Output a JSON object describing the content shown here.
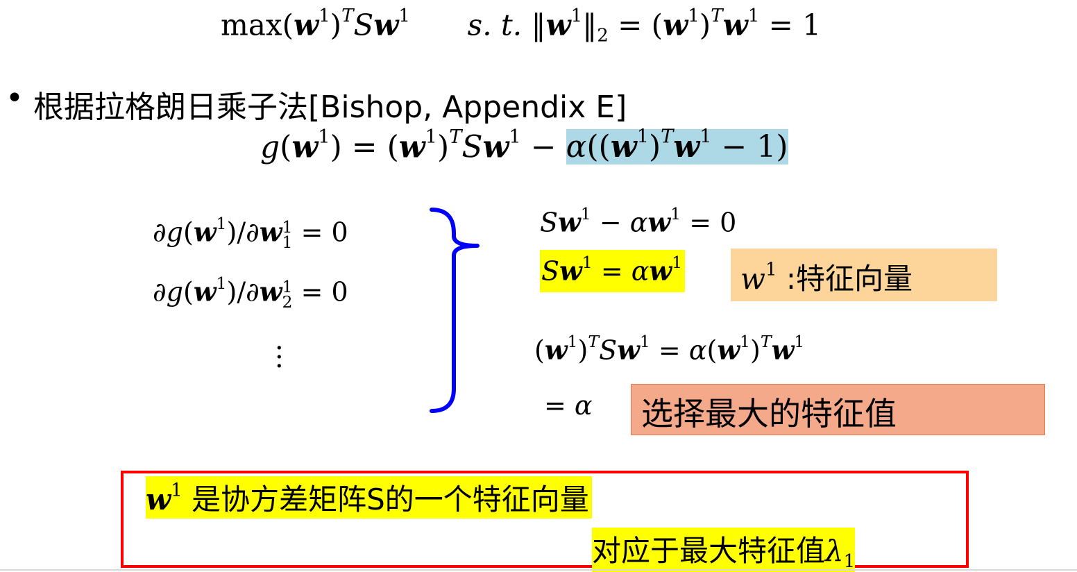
{
  "constraint_eq": {
    "max": "max",
    "st": "s. t.",
    "norm_sub": "2",
    "one": "1"
  },
  "bullet": {
    "marker": "•",
    "text": "根据拉格朗日乘子法[Bishop, Appendix E]"
  },
  "lagrangian": {
    "lhs": "g",
    "alpha": "α",
    "minus_one": "− 1)"
  },
  "partials": {
    "zero": "0",
    "sub1": "1",
    "sub2": "2",
    "vdots": "⋮"
  },
  "results": {
    "eq_zero": "= 0",
    "eq_alpha": "= α",
    "eigvec_label": ":特征向量",
    "choose_label": "选择最大的特征值"
  },
  "conclusion": {
    "line1": "是协方差矩阵S的一个特征向量",
    "line2": "对应于最大特征值",
    "lambda": "λ",
    "lambda_sub": "1"
  },
  "colors": {
    "blue_highlight": "#add8e6",
    "yellow_highlight": "#ffff00",
    "orange_box": "#fdd59a",
    "salmon_box": "#f5a98b",
    "red_border": "#ff0000",
    "brace": "#0000ff"
  }
}
